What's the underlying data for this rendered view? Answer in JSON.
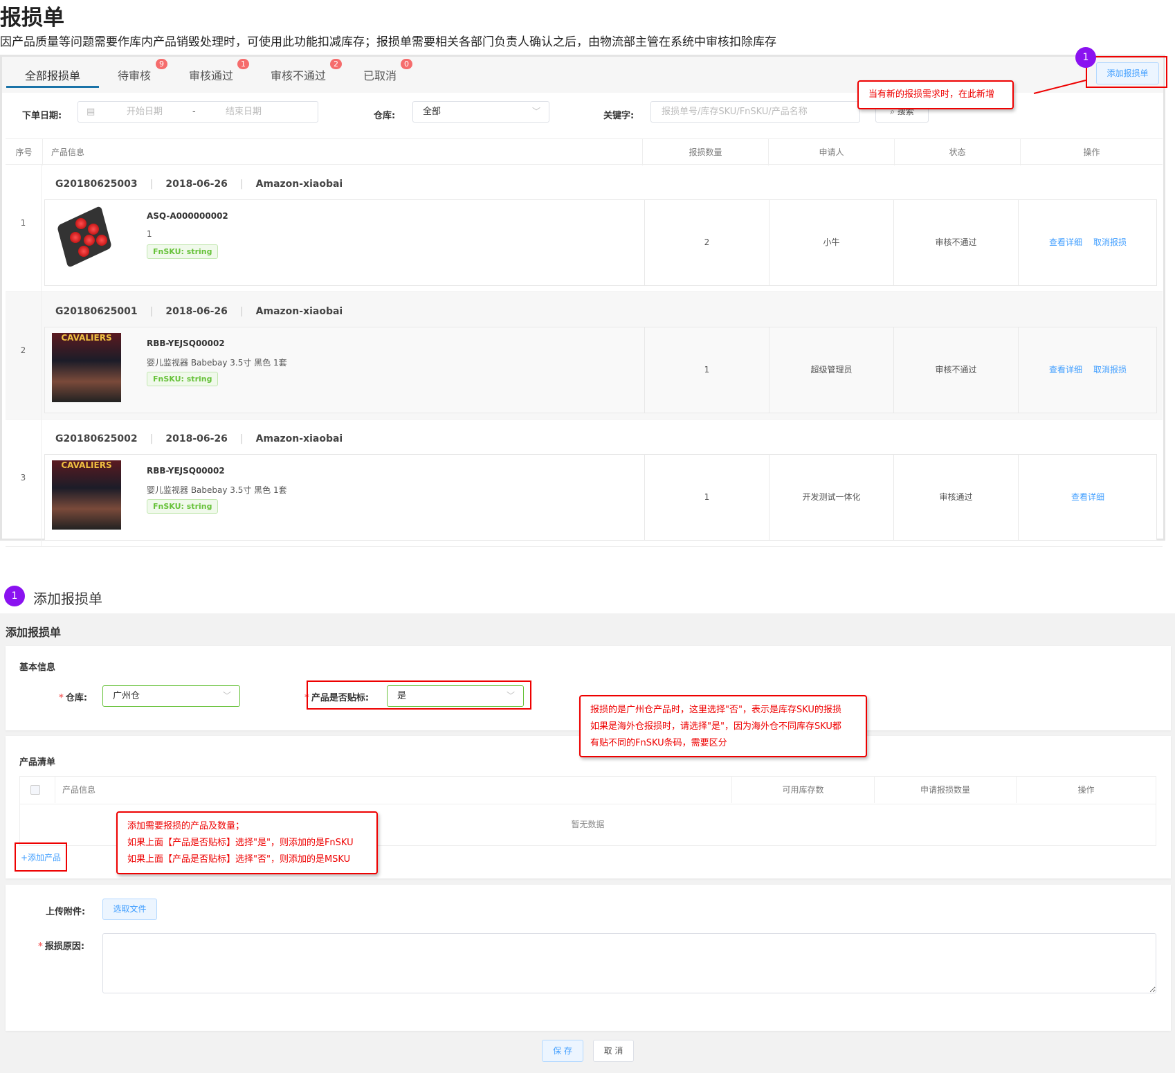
{
  "page": {
    "title": "报损单",
    "description": "因产品质量等问题需要作库内产品销毁处理时，可使用此功能扣减库存；报损单需要相关各部门负责人确认之后，由物流部主管在系统中审核扣除库存"
  },
  "tabs": [
    {
      "label": "全部报损单",
      "badge": null
    },
    {
      "label": "待审核",
      "badge": "9"
    },
    {
      "label": "审核通过",
      "badge": "1"
    },
    {
      "label": "审核不通过",
      "badge": "2"
    },
    {
      "label": "已取消",
      "badge": "0"
    }
  ],
  "add_button": "添加报损单",
  "step_number": "1",
  "callout_add": "当有新的报损需求时，在此新增",
  "filters": {
    "date_label": "下单日期:",
    "start_placeholder": "开始日期",
    "separator": "-",
    "end_placeholder": "结束日期",
    "warehouse_label": "仓库:",
    "warehouse_value": "全部",
    "keyword_label": "关键字:",
    "keyword_placeholder": "报损单号/库存SKU/FnSKU/产品名称",
    "search_button": "搜索"
  },
  "table": {
    "headers": [
      "序号",
      "产品信息",
      "报损数量",
      "申请人",
      "状态",
      "操作"
    ],
    "rows": [
      {
        "index": "1",
        "order_no": "G20180625003",
        "date": "2018-06-26",
        "shop": "Amazon-xiaobai",
        "sku": "ASQ-A000000002",
        "name": "1",
        "fnsku": "FnSKU: string",
        "qty": "2",
        "applicant": "小牛",
        "status": "审核不通过",
        "actions": [
          "查看详细",
          "取消报损"
        ]
      },
      {
        "index": "2",
        "order_no": "G20180625001",
        "date": "2018-06-26",
        "shop": "Amazon-xiaobai",
        "sku": "RBB-YEJSQ00002",
        "name": "婴儿监视器 Babebay 3.5寸 黑色 1套",
        "fnsku": "FnSKU: string",
        "qty": "1",
        "applicant": "超级管理员",
        "status": "审核不通过",
        "actions": [
          "查看详细",
          "取消报损"
        ]
      },
      {
        "index": "3",
        "order_no": "G20180625002",
        "date": "2018-06-26",
        "shop": "Amazon-xiaobai",
        "sku": "RBB-YEJSQ00002",
        "name": "婴儿监视器 Babebay 3.5寸 黑色 1套",
        "fnsku": "FnSKU: string",
        "qty": "1",
        "applicant": "开发测试一体化",
        "status": "审核通过",
        "actions": [
          "查看详细"
        ]
      }
    ],
    "poster_text": "CAVALIERS"
  },
  "section": {
    "step": "1",
    "heading": "添加报损单"
  },
  "form": {
    "title": "添加报损单",
    "basic_info": "基本信息",
    "warehouse_label": "仓库:",
    "warehouse_value": "广州仓",
    "label_flag_label": "产品是否贴标:",
    "label_flag_value": "是",
    "callout_label": [
      "报损的是广州仓产品时，这里选择\"否\"，表示是库存SKU的报损",
      "如果是海外仓报损时，请选择\"是\"，因为海外仓不同库存SKU都",
      "有贴不同的FnSKU条码，需要区分"
    ],
    "product_list": "产品清单",
    "product_headers": [
      "产品信息",
      "可用库存数",
      "申请报损数量",
      "操作"
    ],
    "empty_text": "暂无数据",
    "add_product": "+添加产品",
    "callout_product": [
      "添加需要报损的产品及数量；",
      "如果上面【产品是否贴标】选择\"是\"，则添加的是FnSKU",
      "如果上面【产品是否贴标】选择\"否\"，则添加的是MSKU"
    ],
    "upload_label": "上传附件:",
    "upload_button": "选取文件",
    "reason_label": "报损原因:",
    "reason_value": "",
    "save_button": "保 存",
    "cancel_button": "取 消"
  }
}
